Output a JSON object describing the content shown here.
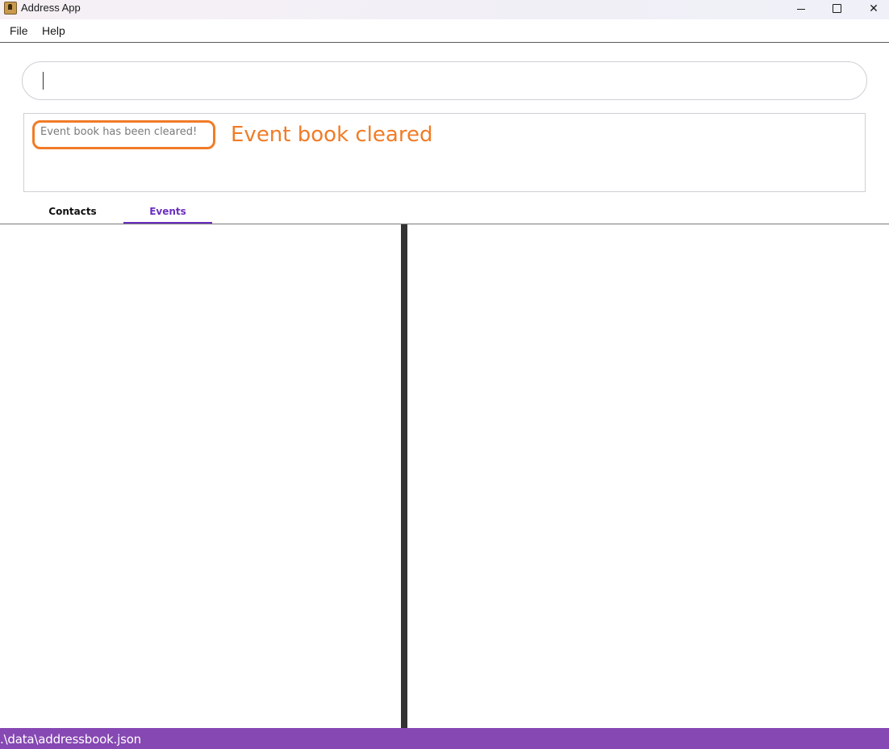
{
  "window": {
    "title": "Address App",
    "icon": "address-book-icon",
    "controls": {
      "minimize": "minimize-icon",
      "maximize": "maximize-icon",
      "close": "✕"
    }
  },
  "menu": {
    "items": [
      {
        "label": "File"
      },
      {
        "label": "Help"
      }
    ]
  },
  "command_box": {
    "value": "",
    "placeholder": ""
  },
  "result": {
    "message": "Event book has been cleared!",
    "annotation": "Event book cleared",
    "highlight_color": "#f07c27"
  },
  "tabs": [
    {
      "label": "Contacts",
      "selected": false
    },
    {
      "label": "Events",
      "selected": true
    }
  ],
  "status_bar": {
    "path": ".\\data\\addressbook.json",
    "color": "#8648b3"
  },
  "colors": {
    "accent": "#6a2fbf",
    "divider": "#333333"
  }
}
